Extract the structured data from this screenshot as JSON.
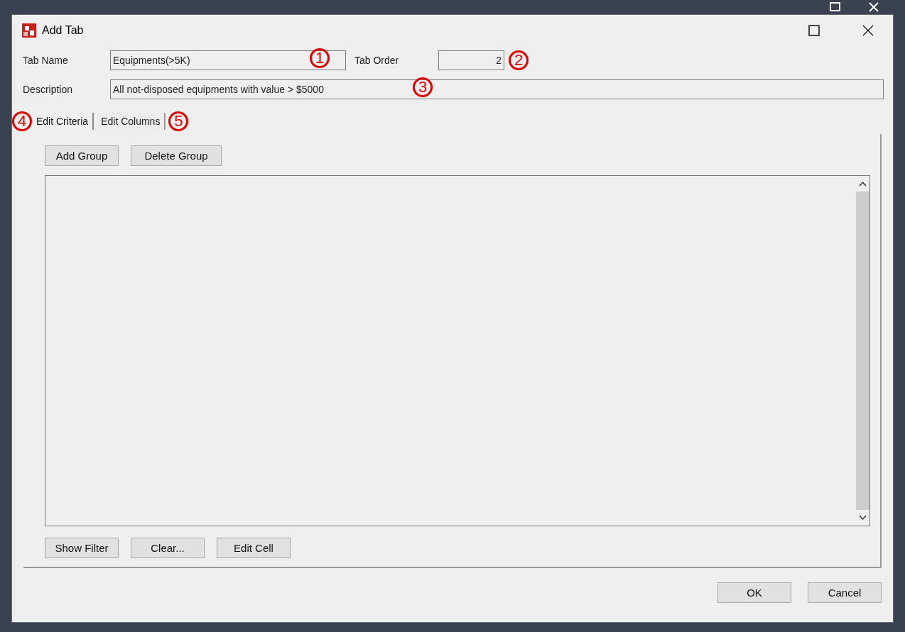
{
  "window": {
    "title": "Add Tab"
  },
  "tab_name": {
    "label": "Tab Name",
    "value": "Equipments(>5K)",
    "callout": "1"
  },
  "tab_order": {
    "label": "Tab Order",
    "value": "2",
    "callout": "2"
  },
  "description": {
    "label": "Description",
    "value": "All not-disposed equipments with value > $5000",
    "callout": "3"
  },
  "tabs": [
    {
      "label": "Edit Criteria",
      "selected": true,
      "callout": "4"
    },
    {
      "label": "Edit Columns",
      "selected": false,
      "callout": "5"
    }
  ],
  "group_buttons": [
    "Add Group",
    "Delete Group"
  ],
  "grid_buttons": [
    "Show Filter",
    "Clear...",
    "Edit Cell"
  ],
  "dialog_buttons": [
    "OK",
    "Cancel"
  ]
}
